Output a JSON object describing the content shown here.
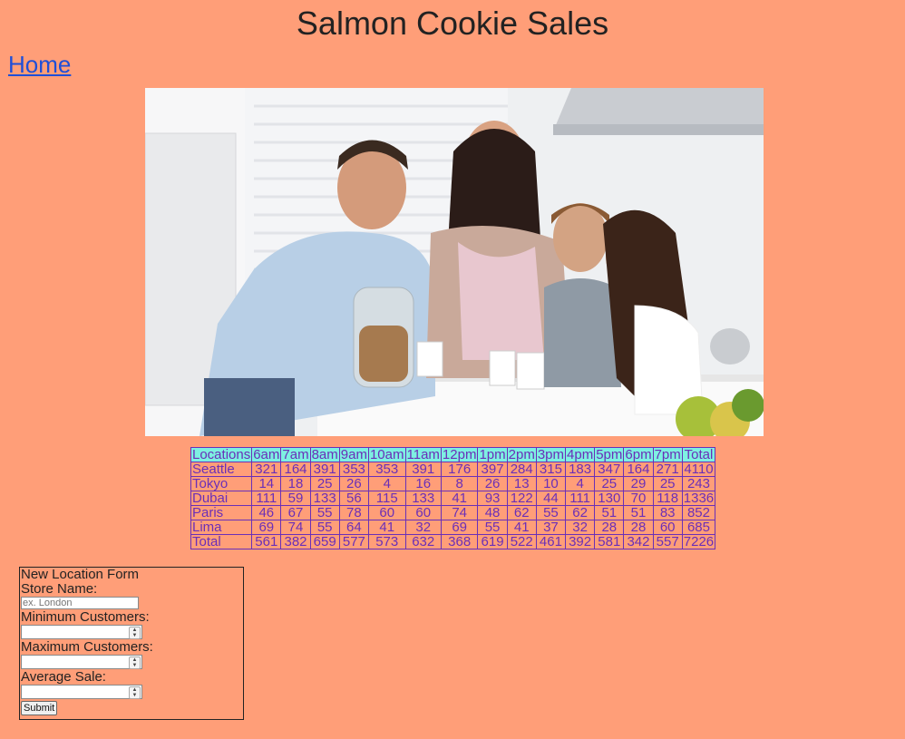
{
  "page": {
    "title": "Salmon Cookie Sales",
    "home_link": "Home"
  },
  "table": {
    "headers": [
      "Locations",
      "6am",
      "7am",
      "8am",
      "9am",
      "10am",
      "11am",
      "12pm",
      "1pm",
      "2pm",
      "3pm",
      "4pm",
      "5pm",
      "6pm",
      "7pm",
      "Total"
    ],
    "rows": [
      [
        "Seattle",
        "321",
        "164",
        "391",
        "353",
        "353",
        "391",
        "176",
        "397",
        "284",
        "315",
        "183",
        "347",
        "164",
        "271",
        "4110"
      ],
      [
        "Tokyo",
        "14",
        "18",
        "25",
        "26",
        "4",
        "16",
        "8",
        "26",
        "13",
        "10",
        "4",
        "25",
        "29",
        "25",
        "243"
      ],
      [
        "Dubai",
        "111",
        "59",
        "133",
        "56",
        "115",
        "133",
        "41",
        "93",
        "122",
        "44",
        "111",
        "130",
        "70",
        "118",
        "1336"
      ],
      [
        "Paris",
        "46",
        "67",
        "55",
        "78",
        "60",
        "60",
        "74",
        "48",
        "62",
        "55",
        "62",
        "51",
        "51",
        "83",
        "852"
      ],
      [
        "Lima",
        "69",
        "74",
        "55",
        "64",
        "41",
        "32",
        "69",
        "55",
        "41",
        "37",
        "32",
        "28",
        "28",
        "60",
        "685"
      ],
      [
        "Total",
        "561",
        "382",
        "659",
        "577",
        "573",
        "632",
        "368",
        "619",
        "522",
        "461",
        "392",
        "581",
        "342",
        "557",
        "7226"
      ]
    ]
  },
  "form": {
    "legend": "New Location Form",
    "store_name_label": "Store Name:",
    "store_name_placeholder": "ex. London",
    "min_label": "Minimum Customers:",
    "max_label": "Maximum Customers:",
    "avg_label": "Average Sale:",
    "submit_label": "Submit"
  },
  "icons": {
    "spinner": "number-spinner-icon"
  }
}
